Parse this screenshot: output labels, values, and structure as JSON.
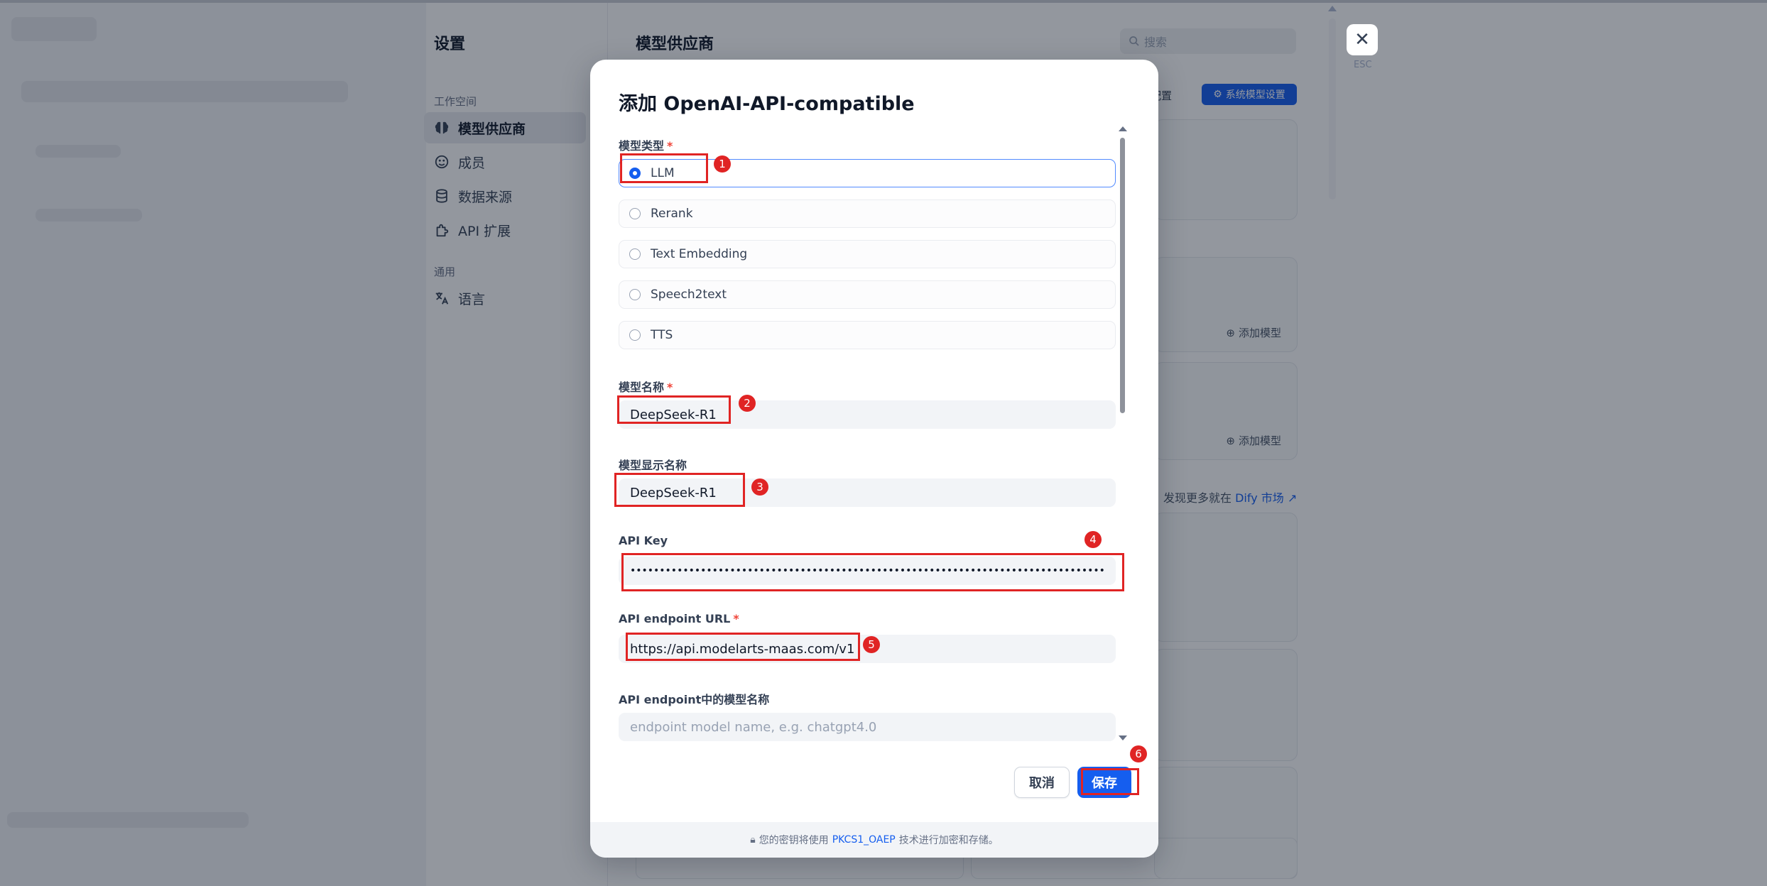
{
  "settings": {
    "title": "设置",
    "workspace_group": "工作空间",
    "general_group": "通用",
    "nav": [
      {
        "label": "模型供应商",
        "icon": "brain-icon"
      },
      {
        "label": "成员",
        "icon": "members-icon"
      },
      {
        "label": "数据来源",
        "icon": "database-icon"
      },
      {
        "label": "API 扩展",
        "icon": "puzzle-icon"
      }
    ],
    "language": {
      "label": "语言",
      "icon": "translate-icon"
    }
  },
  "provider_page": {
    "title": "模型供应商",
    "search_placeholder": "搜索",
    "config_text": "配置",
    "system_model_button": "系统模型设置",
    "add_model_label": "添加模型",
    "discover_prefix": "发现更多就在",
    "discover_link": "Dify 市场",
    "esc_label": "ESC"
  },
  "modal": {
    "title": "添加 OpenAI-API-compatible",
    "model_type_label": "模型类型",
    "model_types": [
      "LLM",
      "Rerank",
      "Text Embedding",
      "Speech2text",
      "TTS"
    ],
    "selected_model_type": "LLM",
    "model_name_label": "模型名称",
    "model_name_value": "DeepSeek-R1",
    "display_name_label": "模型显示名称",
    "display_name_value": "DeepSeek-R1",
    "api_key_label": "API Key",
    "api_key_value": "•••••••••••••••••••••••••••••••••••••••••••••••••••••••••••••••••••••••••••••••••",
    "endpoint_url_label": "API endpoint URL",
    "endpoint_url_value": "https://api.modelarts-maas.com/v1",
    "endpoint_model_label": "API endpoint中的模型名称",
    "endpoint_model_placeholder": "endpoint model name, e.g. chatgpt4.0",
    "cancel_label": "取消",
    "save_label": "保存",
    "footer_prefix": "您的密钥将使用",
    "footer_link": "PKCS1_OAEP",
    "footer_suffix": "技术进行加密和存储。"
  },
  "annotations": [
    "1",
    "2",
    "3",
    "4",
    "5",
    "6"
  ],
  "colors": {
    "accent": "#155eef",
    "annotation": "#e02424",
    "overlay": "rgba(16,24,40,0.45)"
  }
}
